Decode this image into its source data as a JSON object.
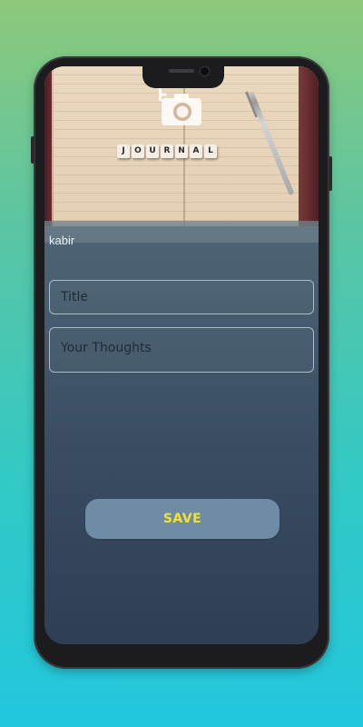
{
  "hero": {
    "journal_letters": [
      "J",
      "O",
      "U",
      "R",
      "N",
      "A",
      "L"
    ],
    "camera_icon": "add-photo-camera-icon"
  },
  "entry": {
    "author": "kabir",
    "title_placeholder": "Title",
    "thoughts_placeholder": "Your Thoughts",
    "title_value": "",
    "thoughts_value": ""
  },
  "actions": {
    "save_label": "SAVE"
  },
  "colors": {
    "save_text": "#f6e22c",
    "save_bg": "#6e8ca5",
    "screen_top": "#5a7380",
    "screen_bottom": "#2f3e55"
  }
}
